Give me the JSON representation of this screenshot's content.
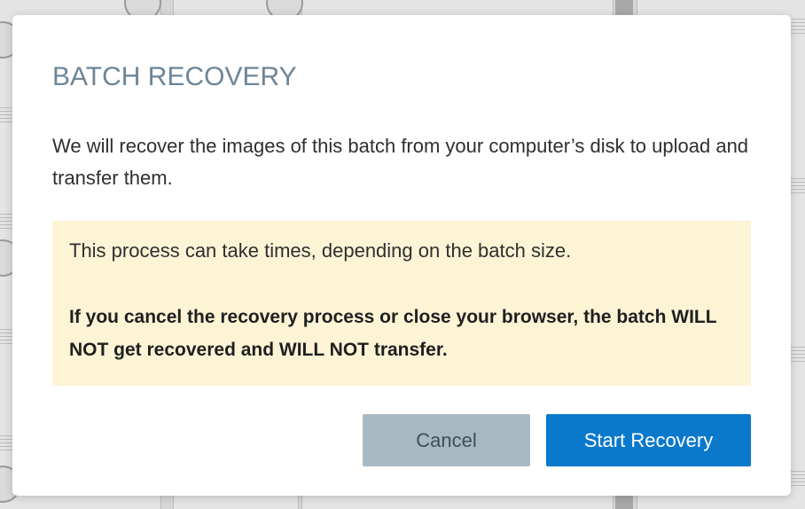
{
  "dialog": {
    "title": "BATCH RECOVERY",
    "description": "We will recover the images of this batch from your computer’s disk to upload and transfer them.",
    "notice": {
      "info": "This process can take times, depending on the batch size.",
      "warning": "If you cancel the recovery process or close your browser, the batch WILL NOT get recovered and WILL NOT transfer."
    },
    "buttons": {
      "cancel": "Cancel",
      "start": "Start Recovery"
    }
  },
  "colors": {
    "title": "#6d8596",
    "notice_background": "#fdf4d6",
    "cancel_button": "#a9b9c4",
    "primary_button": "#0a79cc"
  }
}
